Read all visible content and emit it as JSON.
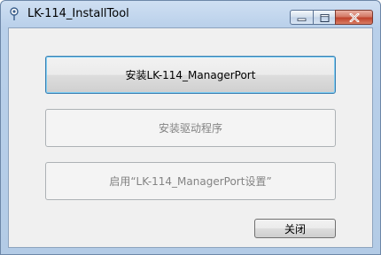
{
  "window": {
    "title": "LK-114_InstallTool"
  },
  "icons": {
    "app": "pin-icon",
    "minimize": "minimize-icon",
    "maximize": "maximize-icon",
    "close": "close-icon"
  },
  "buttons": {
    "install_manager": "安装LK-114_ManagerPort",
    "install_driver": "安装驱动程序",
    "enable_settings": "启用“LK-114_ManagerPort设置”",
    "close": "关闭"
  },
  "colors": {
    "title_bar": "#b9d0ea",
    "close_button": "#c0432c",
    "focus_border": "#3c7fb1"
  }
}
